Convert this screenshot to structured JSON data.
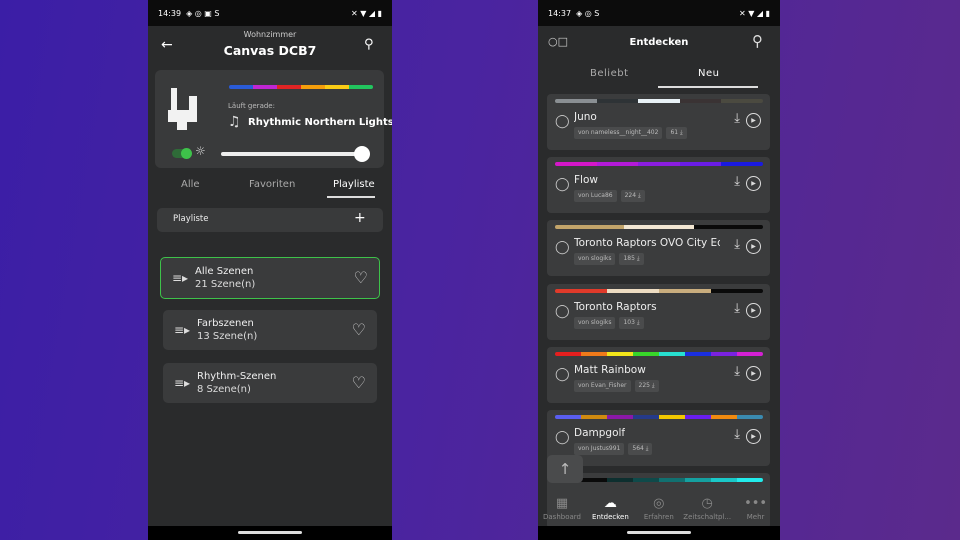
{
  "left": {
    "status": {
      "time": "14:39",
      "icons": [
        "discord-icon",
        "whatsapp-icon",
        "mail-icon",
        "s-app-icon"
      ],
      "right_icons": [
        "mute-icon",
        "wifi-icon",
        "signal-icon",
        "battery-icon"
      ]
    },
    "header": {
      "room": "Wohnzimmer",
      "title": "Canvas DCB7"
    },
    "now_playing": {
      "label": "Läuft gerade:",
      "scene": "Rhythmic Northern Lights",
      "palette": [
        "#2a5bd7",
        "#c026d3",
        "#e02424",
        "#f59e0b",
        "#facc15",
        "#22c55e"
      ],
      "power_on": true,
      "brightness_percent": 100
    },
    "tabs": [
      {
        "label": "Alle"
      },
      {
        "label": "Favoriten"
      },
      {
        "label": "Playliste",
        "active": true
      }
    ],
    "playlist_header": {
      "label": "Playliste",
      "add": "+"
    },
    "playlists": [
      {
        "title": "Alle Szenen",
        "count": "21 Szene(n)",
        "selected": true
      },
      {
        "title": "Farbszenen",
        "count": "13 Szene(n)"
      },
      {
        "title": "Rhythm-Szenen",
        "count": "8 Szene(n)"
      }
    ],
    "accent": "#3ec24a"
  },
  "right": {
    "status": {
      "time": "14:37",
      "icons": [
        "discord-icon",
        "whatsapp-icon",
        "s-app-icon"
      ]
    },
    "header": {
      "title": "Entdecken"
    },
    "tabs": [
      {
        "label": "Beliebt"
      },
      {
        "label": "Neu",
        "active": true
      }
    ],
    "scenes": [
      {
        "name": "Juno",
        "author": "von nameless__night__402",
        "downloads": "61",
        "palette": [
          "#8a8f93",
          "#2e3336",
          "#e8f1f6",
          "#3a3334",
          "#4b4a40"
        ]
      },
      {
        "name": "Flow",
        "author": "von Luca86",
        "downloads": "224",
        "palette": [
          "#d417c9",
          "#b31ad9",
          "#8a1de0",
          "#6a1de6",
          "#1a1ae0"
        ]
      },
      {
        "name": "Toronto Raptors OVO City Edi",
        "author": "von slogiks",
        "downloads": "185",
        "palette": [
          "#c2a46a",
          "#f2e6d2",
          "#0a0a0a"
        ]
      },
      {
        "name": "Toronto Raptors",
        "author": "von slogiks",
        "downloads": "103",
        "palette": [
          "#e03a2a",
          "#eddcc2",
          "#c9ad7e",
          "#0a0a0a"
        ]
      },
      {
        "name": "Matt Rainbow",
        "author": "von Evan_Fisher",
        "downloads": "225",
        "palette": [
          "#e51f1f",
          "#f07a1a",
          "#f2e51a",
          "#38d62a",
          "#27e0d0",
          "#1a2fe0",
          "#7a22e0",
          "#d420d4"
        ]
      },
      {
        "name": "Dampgolf",
        "author": "von Justus991",
        "downloads": "564",
        "palette": [
          "#5a5ef0",
          "#d08a10",
          "#8a18a8",
          "#253a8a",
          "#f2c800",
          "#6a1ef0",
          "#f08a10",
          "#3a8ab0"
        ]
      },
      {
        "name": "",
        "author": "",
        "downloads": "",
        "palette": [
          "#0a0a0a",
          "#0a0a0a",
          "#0d2f2f",
          "#0f4a4a",
          "#117070",
          "#15a0a0",
          "#1ac8c8",
          "#22ecec"
        ]
      }
    ],
    "bottom_nav": [
      {
        "label": "Dashboard",
        "icon": "dashboard-icon"
      },
      {
        "label": "Entdecken",
        "icon": "cloud-download-icon",
        "active": true
      },
      {
        "label": "Erfahren",
        "icon": "compass-icon"
      },
      {
        "label": "Zeitschaltpl...",
        "icon": "clock-icon"
      },
      {
        "label": "Mehr",
        "icon": "more-icon"
      }
    ]
  }
}
